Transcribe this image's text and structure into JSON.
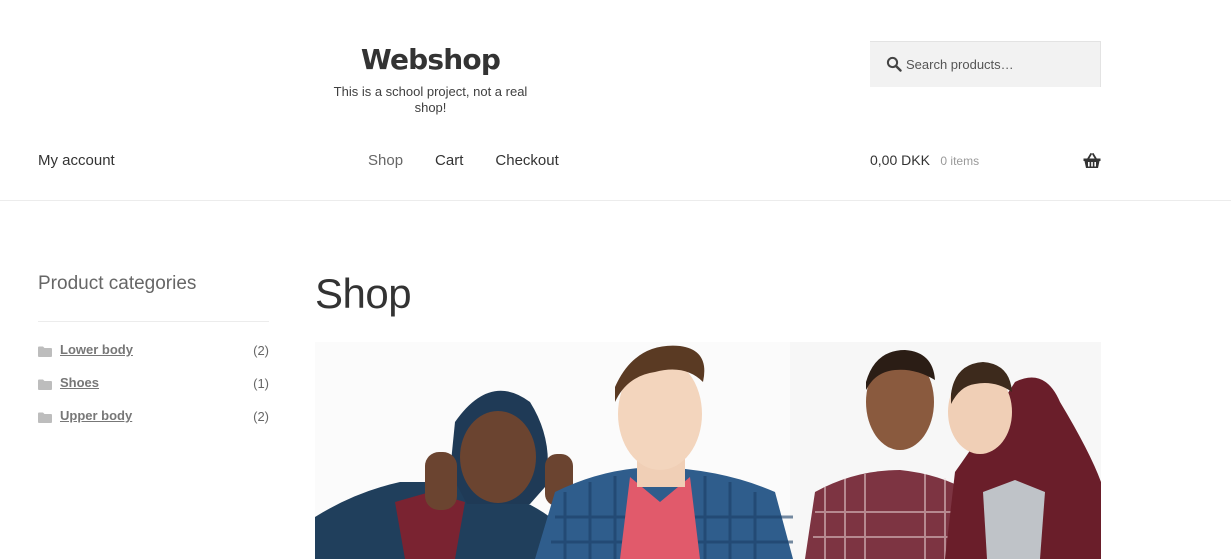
{
  "header": {
    "site_title": "Webshop",
    "site_description": "This is a school project, not a real shop!",
    "search": {
      "placeholder": "Search products…"
    }
  },
  "nav": {
    "account_label": "My account",
    "items": [
      {
        "label": "Shop",
        "current": true
      },
      {
        "label": "Cart",
        "current": false
      },
      {
        "label": "Checkout",
        "current": false
      }
    ]
  },
  "cart": {
    "amount": "0,00 DKK",
    "count": "0 items",
    "icon": "basket-icon"
  },
  "sidebar": {
    "title": "Product categories",
    "categories": [
      {
        "name": "Lower body",
        "count": "(2)"
      },
      {
        "name": "Shoes",
        "count": "(1)"
      },
      {
        "name": "Upper body",
        "count": "(2)"
      }
    ]
  },
  "main": {
    "title": "Shop"
  },
  "colors": {
    "text": "#333333",
    "muted": "#666666",
    "search_bg": "#f2f2f2"
  }
}
